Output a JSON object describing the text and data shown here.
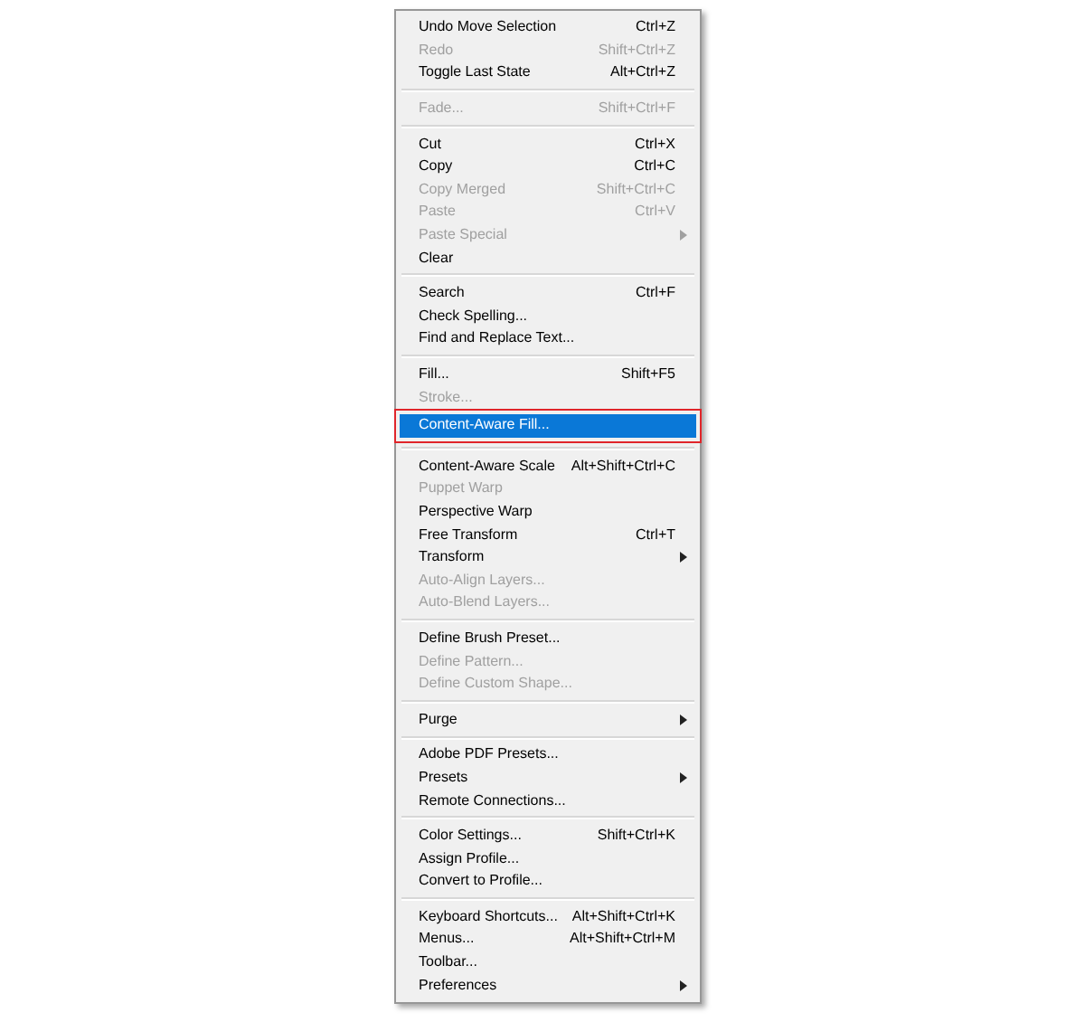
{
  "menu": {
    "sections": [
      {
        "items": [
          {
            "label": "Undo Move Selection",
            "shortcut": "Ctrl+Z",
            "disabled": false,
            "submenu": false,
            "selected": false
          },
          {
            "label": "Redo",
            "shortcut": "Shift+Ctrl+Z",
            "disabled": true,
            "submenu": false,
            "selected": false
          },
          {
            "label": "Toggle Last State",
            "shortcut": "Alt+Ctrl+Z",
            "disabled": false,
            "submenu": false,
            "selected": false
          }
        ]
      },
      {
        "items": [
          {
            "label": "Fade...",
            "shortcut": "Shift+Ctrl+F",
            "disabled": true,
            "submenu": false,
            "selected": false
          }
        ]
      },
      {
        "items": [
          {
            "label": "Cut",
            "shortcut": "Ctrl+X",
            "disabled": false,
            "submenu": false,
            "selected": false
          },
          {
            "label": "Copy",
            "shortcut": "Ctrl+C",
            "disabled": false,
            "submenu": false,
            "selected": false
          },
          {
            "label": "Copy Merged",
            "shortcut": "Shift+Ctrl+C",
            "disabled": true,
            "submenu": false,
            "selected": false
          },
          {
            "label": "Paste",
            "shortcut": "Ctrl+V",
            "disabled": true,
            "submenu": false,
            "selected": false
          },
          {
            "label": "Paste Special",
            "disabled": true,
            "submenu": true,
            "selected": false
          },
          {
            "label": "Clear",
            "disabled": false,
            "submenu": false,
            "selected": false
          }
        ]
      },
      {
        "items": [
          {
            "label": "Search",
            "shortcut": "Ctrl+F",
            "disabled": false,
            "submenu": false,
            "selected": false
          },
          {
            "label": "Check Spelling...",
            "disabled": false,
            "submenu": false,
            "selected": false
          },
          {
            "label": "Find and Replace Text...",
            "disabled": false,
            "submenu": false,
            "selected": false
          }
        ]
      },
      {
        "items": [
          {
            "label": "Fill...",
            "shortcut": "Shift+F5",
            "disabled": false,
            "submenu": false,
            "selected": false
          },
          {
            "label": "Stroke...",
            "disabled": true,
            "submenu": false,
            "selected": false
          },
          {
            "label": "Content-Aware Fill...",
            "disabled": false,
            "submenu": false,
            "selected": true
          }
        ]
      },
      {
        "items": [
          {
            "label": "Content-Aware Scale",
            "shortcut": "Alt+Shift+Ctrl+C",
            "disabled": false,
            "submenu": false,
            "selected": false
          },
          {
            "label": "Puppet Warp",
            "disabled": true,
            "submenu": false,
            "selected": false
          },
          {
            "label": "Perspective Warp",
            "disabled": false,
            "submenu": false,
            "selected": false
          },
          {
            "label": "Free Transform",
            "shortcut": "Ctrl+T",
            "disabled": false,
            "submenu": false,
            "selected": false
          },
          {
            "label": "Transform",
            "disabled": false,
            "submenu": true,
            "selected": false
          },
          {
            "label": "Auto-Align Layers...",
            "disabled": true,
            "submenu": false,
            "selected": false
          },
          {
            "label": "Auto-Blend Layers...",
            "disabled": true,
            "submenu": false,
            "selected": false
          }
        ]
      },
      {
        "items": [
          {
            "label": "Define Brush Preset...",
            "disabled": false,
            "submenu": false,
            "selected": false
          },
          {
            "label": "Define Pattern...",
            "disabled": true,
            "submenu": false,
            "selected": false
          },
          {
            "label": "Define Custom Shape...",
            "disabled": true,
            "submenu": false,
            "selected": false
          }
        ]
      },
      {
        "items": [
          {
            "label": "Purge",
            "disabled": false,
            "submenu": true,
            "selected": false
          }
        ]
      },
      {
        "items": [
          {
            "label": "Adobe PDF Presets...",
            "disabled": false,
            "submenu": false,
            "selected": false
          },
          {
            "label": "Presets",
            "disabled": false,
            "submenu": true,
            "selected": false
          },
          {
            "label": "Remote Connections...",
            "disabled": false,
            "submenu": false,
            "selected": false
          }
        ]
      },
      {
        "items": [
          {
            "label": "Color Settings...",
            "shortcut": "Shift+Ctrl+K",
            "disabled": false,
            "submenu": false,
            "selected": false
          },
          {
            "label": "Assign Profile...",
            "disabled": false,
            "submenu": false,
            "selected": false
          },
          {
            "label": "Convert to Profile...",
            "disabled": false,
            "submenu": false,
            "selected": false
          }
        ]
      },
      {
        "items": [
          {
            "label": "Keyboard Shortcuts...",
            "shortcut": "Alt+Shift+Ctrl+K",
            "disabled": false,
            "submenu": false,
            "selected": false
          },
          {
            "label": "Menus...",
            "shortcut": "Alt+Shift+Ctrl+M",
            "disabled": false,
            "submenu": false,
            "selected": false
          },
          {
            "label": "Toolbar...",
            "disabled": false,
            "submenu": false,
            "selected": false
          },
          {
            "label": "Preferences",
            "disabled": false,
            "submenu": true,
            "selected": false
          }
        ]
      }
    ]
  }
}
